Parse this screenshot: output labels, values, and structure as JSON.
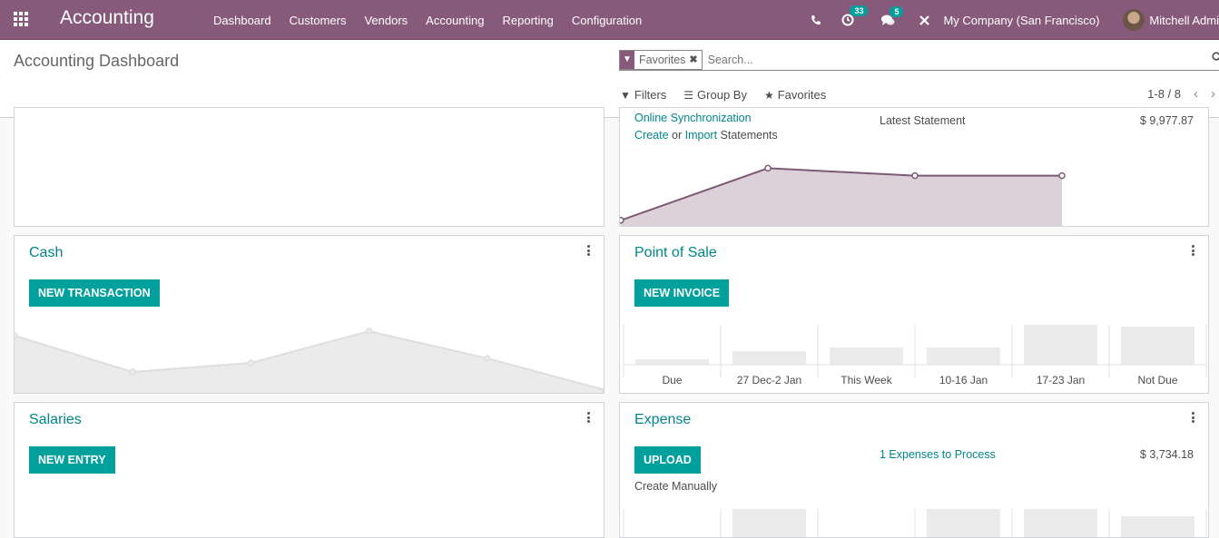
{
  "navbar": {
    "app_title": "Accounting",
    "menu": [
      "Dashboard",
      "Customers",
      "Vendors",
      "Accounting",
      "Reporting",
      "Configuration"
    ],
    "activity_count": "33",
    "message_count": "5",
    "company": "My Company (San Francisco)",
    "user": "Mitchell Admi"
  },
  "control_panel": {
    "title": "Accounting Dashboard",
    "facet_label": "Favorites",
    "search_placeholder": "Search...",
    "filters_label": "Filters",
    "groupby_label": "Group By",
    "favorites_label": "Favorites",
    "pager": "1-8 / 8"
  },
  "cards": {
    "bank": {
      "online_sync": "Online Synchronization",
      "create": "Create",
      "or": "or",
      "import": "Import",
      "statements": "Statements",
      "latest_statement_label": "Latest Statement",
      "latest_statement_value": "$ 9,977.87",
      "line_values": [
        2,
        16,
        14,
        14
      ],
      "accent": "#875a7b"
    },
    "cash": {
      "title": "Cash",
      "button": "NEW TRANSACTION",
      "line_values": [
        13,
        5,
        7,
        14,
        8,
        1
      ]
    },
    "pos": {
      "title": "Point of Sale",
      "button": "NEW INVOICE",
      "categories": [
        "Due",
        "27 Dec-2 Jan",
        "This Week",
        "10-16 Jan",
        "17-23 Jan",
        "Not Due"
      ],
      "values": [
        6,
        15,
        19,
        19,
        44,
        42
      ]
    },
    "salaries": {
      "title": "Salaries",
      "button": "NEW ENTRY"
    },
    "expense": {
      "title": "Expense",
      "button": "UPLOAD",
      "create_manually": "Create Manually",
      "to_process": "1 Expenses to Process",
      "amount": "$ 3,734.18",
      "values": [
        0,
        30,
        0,
        30,
        30,
        22
      ]
    }
  }
}
